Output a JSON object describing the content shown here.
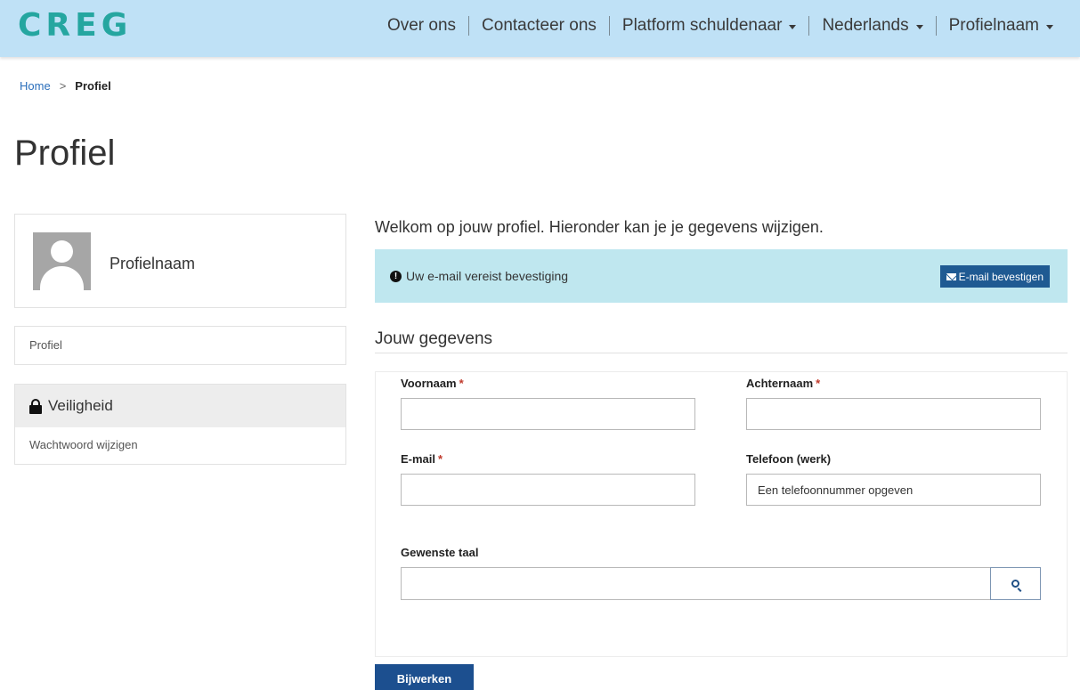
{
  "header": {
    "logo": "CREG",
    "nav": [
      {
        "label": "Over ons",
        "dropdown": false
      },
      {
        "label": "Contacteer ons",
        "dropdown": false
      },
      {
        "label": "Platform schuldenaar",
        "dropdown": true
      },
      {
        "label": "Nederlands",
        "dropdown": true
      },
      {
        "label": "Profielnaam",
        "dropdown": true
      }
    ]
  },
  "breadcrumb": {
    "home": "Home",
    "separator": ">",
    "current": "Profiel"
  },
  "page_title": "Profiel",
  "sidebar": {
    "profile_name": "Profielnaam",
    "profile_link": "Profiel",
    "security_title": "Veiligheid",
    "change_password": "Wachtwoord wijzigen"
  },
  "main": {
    "welcome": "Welkom op jouw profiel. Hieronder kan je je gegevens wijzigen.",
    "alert": {
      "icon": "!",
      "text": "Uw e-mail vereist bevestiging",
      "button": "E-mail bevestigen"
    },
    "section_title": "Jouw gegevens",
    "form": {
      "first_name_label": "Voornaam",
      "last_name_label": "Achternaam",
      "email_label": "E-mail",
      "phone_label": "Telefoon (werk)",
      "phone_placeholder": "Een telefoonnummer opgeven",
      "language_label": "Gewenste taal",
      "required_mark": "*",
      "first_name_value": "",
      "last_name_value": "",
      "email_value": "",
      "language_value": ""
    },
    "submit": "Bijwerken"
  },
  "colors": {
    "header_bg": "#bfe1f6",
    "logo": "#25a6a0",
    "alert_bg": "#bfe7ef",
    "primary_button": "#1c4f8f",
    "required": "#c0392b"
  }
}
